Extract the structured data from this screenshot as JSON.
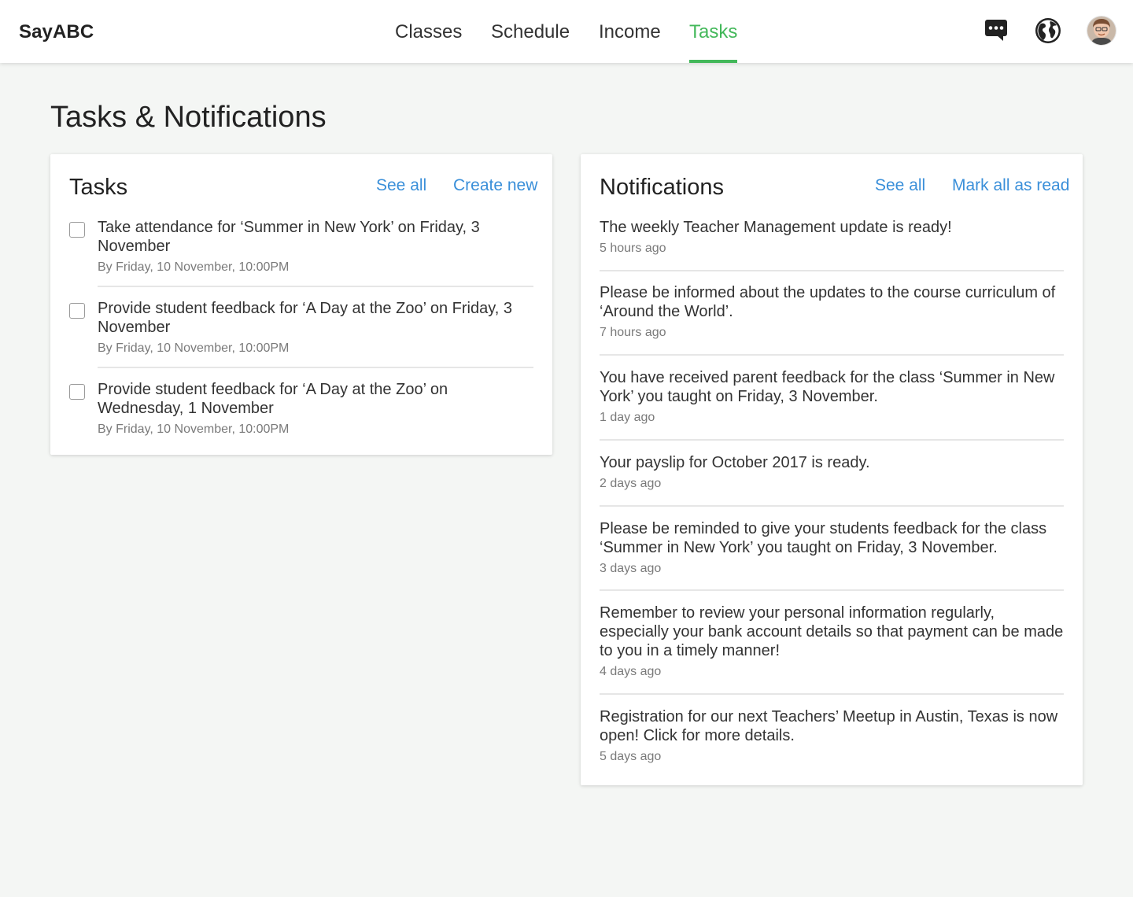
{
  "app": {
    "brand": "SayABC"
  },
  "nav": {
    "items": [
      {
        "label": "Classes"
      },
      {
        "label": "Schedule"
      },
      {
        "label": "Income"
      },
      {
        "label": "Tasks",
        "active": true
      }
    ],
    "accent_color": "#43b85a"
  },
  "header_icons": [
    "chat-icon",
    "globe-icon",
    "avatar"
  ],
  "page": {
    "title": "Tasks & Notifications"
  },
  "tasks": {
    "title": "Tasks",
    "see_all_label": "See all",
    "create_new_label": "Create new",
    "items": [
      {
        "text": "Take attendance for ‘Summer in New York’ on Friday, 3 November",
        "due": "By Friday, 10 November, 10:00PM",
        "checked": false
      },
      {
        "text": "Provide student feedback for ‘A Day at the Zoo’ on Friday, 3 November",
        "due": "By Friday, 10 November, 10:00PM",
        "checked": false
      },
      {
        "text": "Provide student feedback for ‘A Day at the Zoo’ on Wednesday, 1 November",
        "due": "By Friday, 10 November, 10:00PM",
        "checked": false
      }
    ]
  },
  "notifications": {
    "title": "Notifications",
    "see_all_label": "See all",
    "mark_all_label": "Mark all as read",
    "link_color": "#3a8fd9",
    "items": [
      {
        "text": "The weekly Teacher Management update is ready!",
        "time": "5 hours ago"
      },
      {
        "text": "Please be informed about the updates to the course curriculum of ‘Around the World’.",
        "time": "7 hours ago"
      },
      {
        "text": "You have received parent feedback for the class ‘Summer in New York’ you taught on Friday, 3 November.",
        "time": "1 day ago"
      },
      {
        "text": "Your payslip for October 2017 is ready.",
        "time": "2 days ago"
      },
      {
        "text": "Please be reminded to give your students feedback for the class ‘Summer in New York’ you taught on Friday, 3 November.",
        "time": "3 days ago"
      },
      {
        "text": "Remember to review your personal information regularly, especially your bank account details so that payment can be made to you in a timely manner!",
        "time": "4 days ago"
      },
      {
        "text": "Registration for our next Teachers’ Meetup in Austin, Texas is now open! Click for more details.",
        "time": "5 days ago"
      }
    ]
  }
}
